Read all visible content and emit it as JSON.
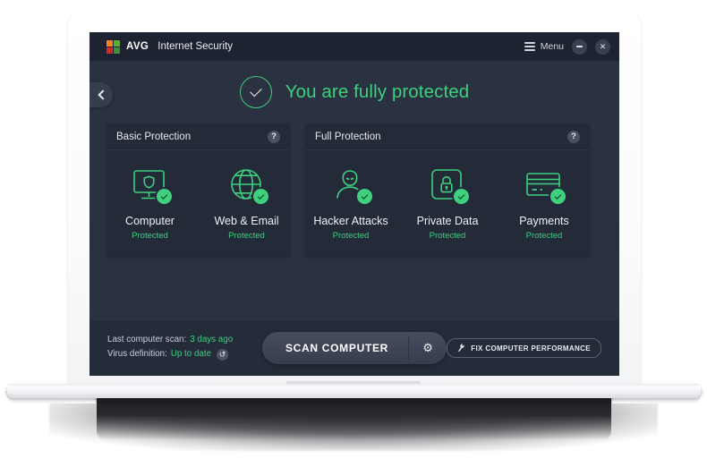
{
  "window": {
    "brand_mark": "AVG",
    "brand_logo_icon": "avg-tiles-logo",
    "title": "Internet Security",
    "menu_label": "Menu",
    "menu_icon": "hamburger-icon",
    "minimize_icon": "minimize-icon",
    "close_icon": "close-icon",
    "close_glyph": "✕"
  },
  "navigation": {
    "back_icon": "chevron-left-icon"
  },
  "status": {
    "icon": "check-circle-icon",
    "headline": "You are fully protected",
    "accent_color": "#3ecf7f"
  },
  "panels": [
    {
      "id": "basic",
      "title": "Basic Protection",
      "help_icon": "help-icon",
      "help_glyph": "?",
      "tiles": [
        {
          "icon": "computer-monitor-shield-icon",
          "name": "Computer",
          "state": "Protected",
          "badge_icon": "check-badge-icon"
        },
        {
          "icon": "globe-icon",
          "name": "Web & Email",
          "state": "Protected",
          "badge_icon": "check-badge-icon"
        }
      ]
    },
    {
      "id": "full",
      "title": "Full Protection",
      "help_icon": "help-icon",
      "help_glyph": "?",
      "tiles": [
        {
          "icon": "hacker-person-icon",
          "name": "Hacker Attacks",
          "state": "Protected",
          "badge_icon": "check-badge-icon"
        },
        {
          "icon": "padlock-icon",
          "name": "Private Data",
          "state": "Protected",
          "badge_icon": "check-badge-icon"
        },
        {
          "icon": "credit-card-icon",
          "name": "Payments",
          "state": "Protected",
          "badge_icon": "check-badge-icon"
        }
      ]
    }
  ],
  "footer": {
    "last_scan_label": "Last computer scan:",
    "last_scan_value": "3 days ago",
    "virus_def_label": "Virus definition:",
    "virus_def_value": "Up to date",
    "refresh_icon": "refresh-icon",
    "refresh_glyph": "↺",
    "scan_button_label": "SCAN COMPUTER",
    "scan_settings_icon": "gear-icon",
    "scan_settings_glyph": "⚙",
    "fix_button_label": "FIX COMPUTER PERFORMANCE",
    "fix_button_icon": "wrench-icon",
    "fix_button_glyph": "🔧"
  }
}
